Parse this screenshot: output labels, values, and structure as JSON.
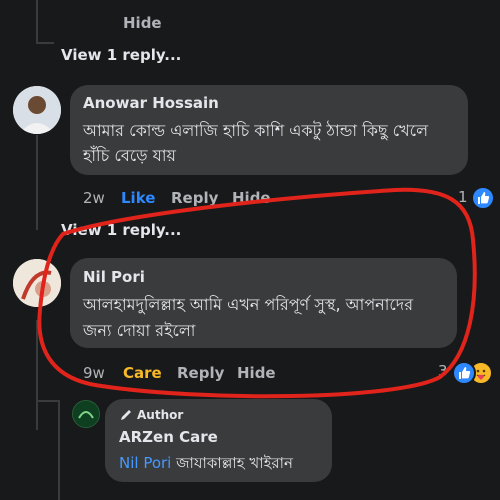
{
  "top": {
    "hide_label": "Hide",
    "view_reply_label": "View 1 reply..."
  },
  "comments": [
    {
      "author": "Anowar Hossain",
      "text_line1": "আমার কোল্ড এলাজি হাচি কাশি একটু ঠান্ডা কিছু খেলে",
      "text_line2": "হাঁচি বেড়ে যায়",
      "time": "2w",
      "like_label": "Like",
      "reply_label": "Reply",
      "hide_label": "Hide",
      "reaction_count": "1",
      "view_reply_label": "View 1 reply..."
    },
    {
      "author": "Nil Pori",
      "text_line1": "আলহামদুলিল্লাহ আমি এখন পরিপূর্ণ সুস্থ, আপনাদের",
      "text_line2": "জন্য দোয়া রইলো",
      "time": "9w",
      "care_label": "Care",
      "reply_label": "Reply",
      "hide_label": "Hide",
      "reaction_count": "3"
    }
  ],
  "reply": {
    "badge": "Author",
    "author": "ARZen Care",
    "mention": "Nil Pori",
    "text": " জাযাকাল্লাহ খাইরান"
  },
  "colors": {
    "accent_blue": "#2e89ff",
    "care_yellow": "#f7b928",
    "annotation_red": "#e0241b"
  }
}
